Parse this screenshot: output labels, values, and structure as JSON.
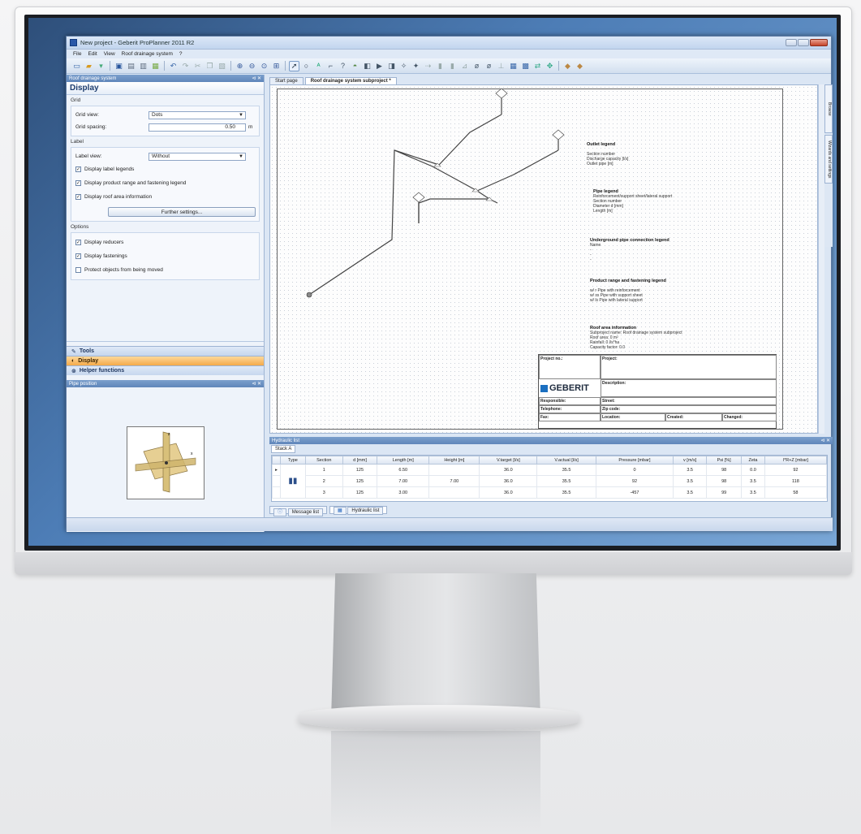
{
  "window": {
    "title": "New project - Geberit ProPlanner 2011 R2",
    "menu": [
      "File",
      "Edit",
      "View",
      "Roof drainage system",
      "?"
    ]
  },
  "left_panel": {
    "caption": "Roof drainage system",
    "title": "Display",
    "grid": {
      "group_label": "Grid",
      "view_label": "Grid view:",
      "view_value": "Dots",
      "spacing_label": "Grid spacing:",
      "spacing_value": "0.50",
      "spacing_unit": "m"
    },
    "label": {
      "group_label": "Label",
      "view_label": "Label view:",
      "view_value": "Without",
      "checks": [
        "Display label legends",
        "Display product range and fastening legend",
        "Display roof area information"
      ],
      "further_button": "Further settings..."
    },
    "options": {
      "group_label": "Options",
      "checks": [
        {
          "label": "Display reducers",
          "checked": true
        },
        {
          "label": "Display fastenings",
          "checked": true
        },
        {
          "label": "Protect objects from being moved",
          "checked": false
        }
      ]
    },
    "nav": [
      "Tools",
      "Display",
      "Helper functions"
    ],
    "pipe_position_caption": "Pipe position"
  },
  "doc_tabs": [
    "Start page",
    "Roof drainage system subproject *"
  ],
  "legends": {
    "outlet": {
      "title": "Outlet legend",
      "lines": [
        "Section number",
        "Discharge capacity [l/s]",
        "Outlet pipe [m]"
      ]
    },
    "pipe": {
      "title": "Pipe legend",
      "lines": [
        "Reinforcement/support sheet/lateral support",
        "Section number",
        "Diameter d [mm]",
        "Length [m]"
      ]
    },
    "underground": {
      "title": "Underground pipe connection legend",
      "lines": [
        "Name",
        "-",
        "-",
        "-"
      ]
    },
    "product": {
      "title": "Product range and fastening legend",
      "lines": [
        "w/ r    Pipe with reinforcement",
        "w/ ss   Pipe with support sheet",
        "w/ ls   Pipe with lateral support"
      ]
    },
    "roof": {
      "title": "Roof area information",
      "lines": [
        "Subproject name: Roof drainage system subproject",
        "Roof area: 0 m²",
        "Rainfall: 0 l/s*ha",
        "Capacity factor: 0.0"
      ]
    }
  },
  "title_block": {
    "project_no": "Project no.:",
    "project": "Project:",
    "description": "Description:",
    "responsible": "Responsible:",
    "street": "Street:",
    "telephone": "Telephone:",
    "zip": "Zip code:",
    "fax": "Fax:",
    "location": "Location:",
    "created": "Created:",
    "changed": "Changed:",
    "brand": "GEBERIT"
  },
  "side_tabs": [
    "Browse",
    "Wizards and settings"
  ],
  "hydraulic": {
    "caption": "Hydraulic list",
    "stack_tab": "Stack A",
    "columns": [
      "Type",
      "Section",
      "d [mm]",
      "Length [m]",
      "Height [m]",
      "V.target [l/s]",
      "V.actual [l/s]",
      "Pressure [mbar]",
      "v [m/s]",
      "Psi [%]",
      "Zeta",
      "l*R+Z [mbar]"
    ],
    "rows": [
      [
        "",
        "1",
        "125",
        "6.50",
        "",
        "36.0",
        "35.5",
        "0",
        "3.5",
        "98",
        "0.0",
        "92"
      ],
      [
        "",
        "2",
        "125",
        "7.00",
        "7.00",
        "36.0",
        "35.5",
        "92",
        "3.5",
        "98",
        "3.5",
        "118"
      ],
      [
        "",
        "3",
        "125",
        "3.00",
        "",
        "36.0",
        "35.5",
        "-457",
        "3.5",
        "99",
        "3.5",
        "58"
      ]
    ]
  },
  "bottom_tabs": [
    "Message list",
    "Hydraulic list"
  ],
  "colors": {
    "active_nav": "#f4a949",
    "brand_blue": "#1b6fc0",
    "window_frame": "#5c7aa3"
  },
  "icons": [
    "new-icon",
    "open-icon",
    "save-icon",
    "print-icon",
    "zoom-in-icon",
    "zoom-out-icon",
    "pointer-icon",
    "help-icon"
  ]
}
